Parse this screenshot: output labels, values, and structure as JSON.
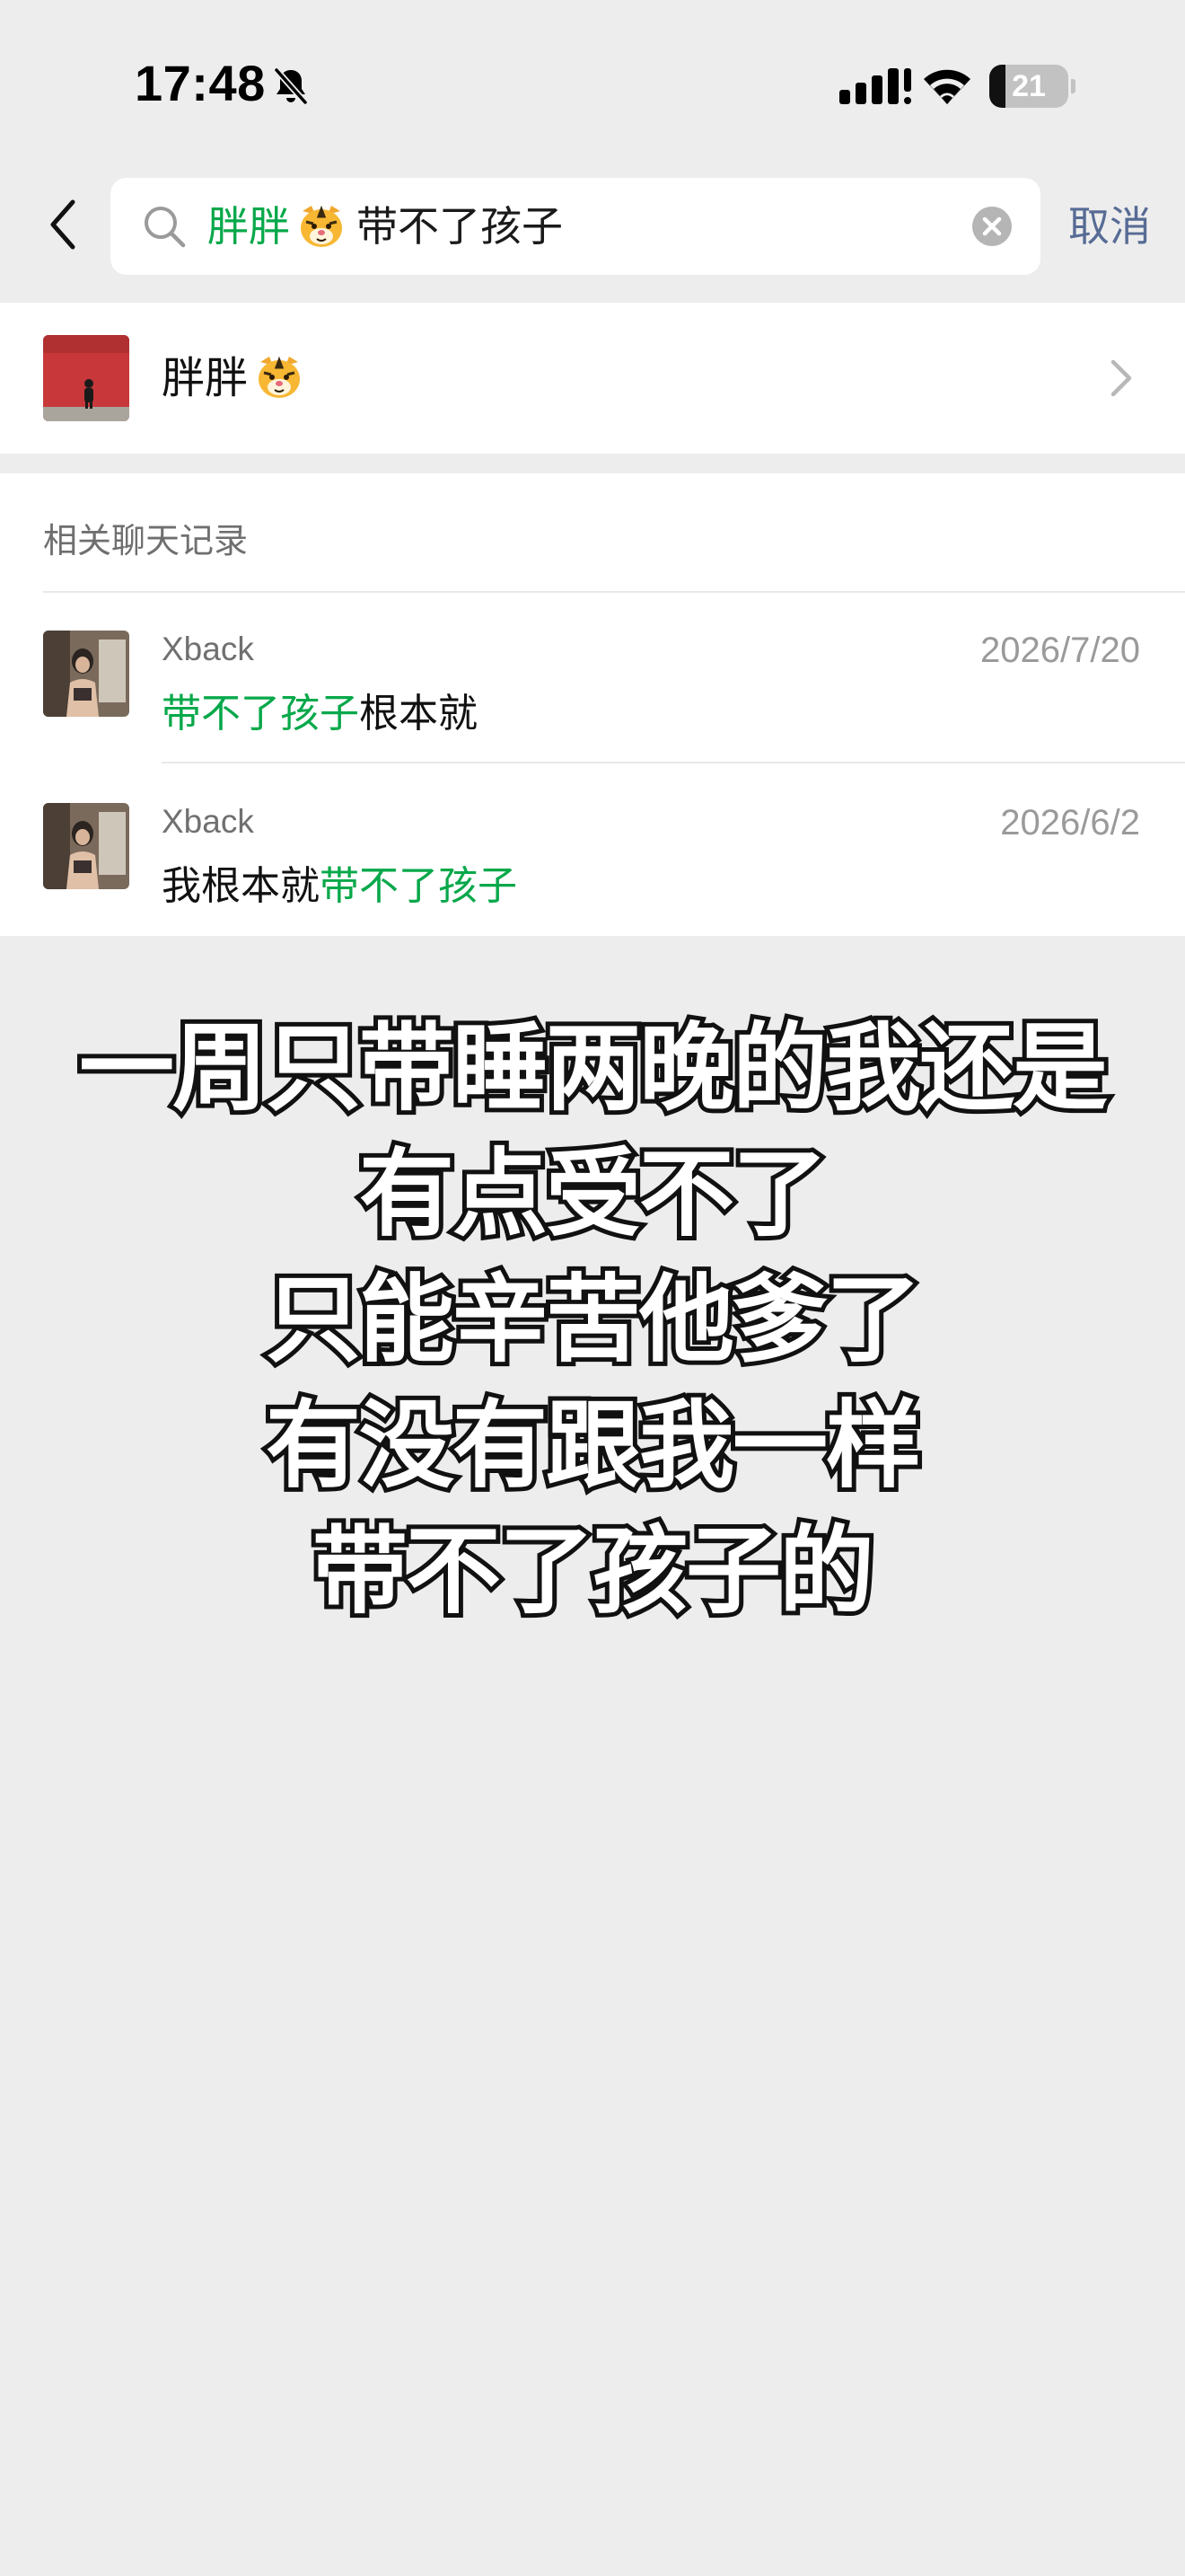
{
  "status_bar": {
    "time": "17:48",
    "battery_level": "21",
    "battery_fraction": 0.21,
    "icons": [
      "bell-slash-icon",
      "signal-icon",
      "wifi-icon",
      "battery-icon"
    ]
  },
  "search": {
    "query_highlight": "胖胖",
    "query_emoji": "tiger-face-emoji",
    "query_rest": "带不了孩子",
    "cancel_label": "取消"
  },
  "contact": {
    "name": "胖胖",
    "name_emoji": "tiger-face-emoji"
  },
  "records": {
    "heading": "相关聊天记录",
    "items": [
      {
        "sender": "Xback",
        "date": "2026/7/20",
        "message_highlight": "带不了孩子",
        "message_rest": "根本就"
      },
      {
        "sender": "Xback",
        "date": "2026/6/2",
        "message_prefix": "我根本就",
        "message_highlight": "带不了孩子"
      }
    ]
  },
  "caption": {
    "lines": [
      "一周只带睡两晚的我还是",
      "有点受不了",
      "只能辛苦他爹了",
      "有没有跟我一样",
      "带不了孩子的"
    ]
  },
  "colors": {
    "background": "#ededed",
    "highlight_green": "#07a84a",
    "cancel_blue": "#576b95"
  }
}
